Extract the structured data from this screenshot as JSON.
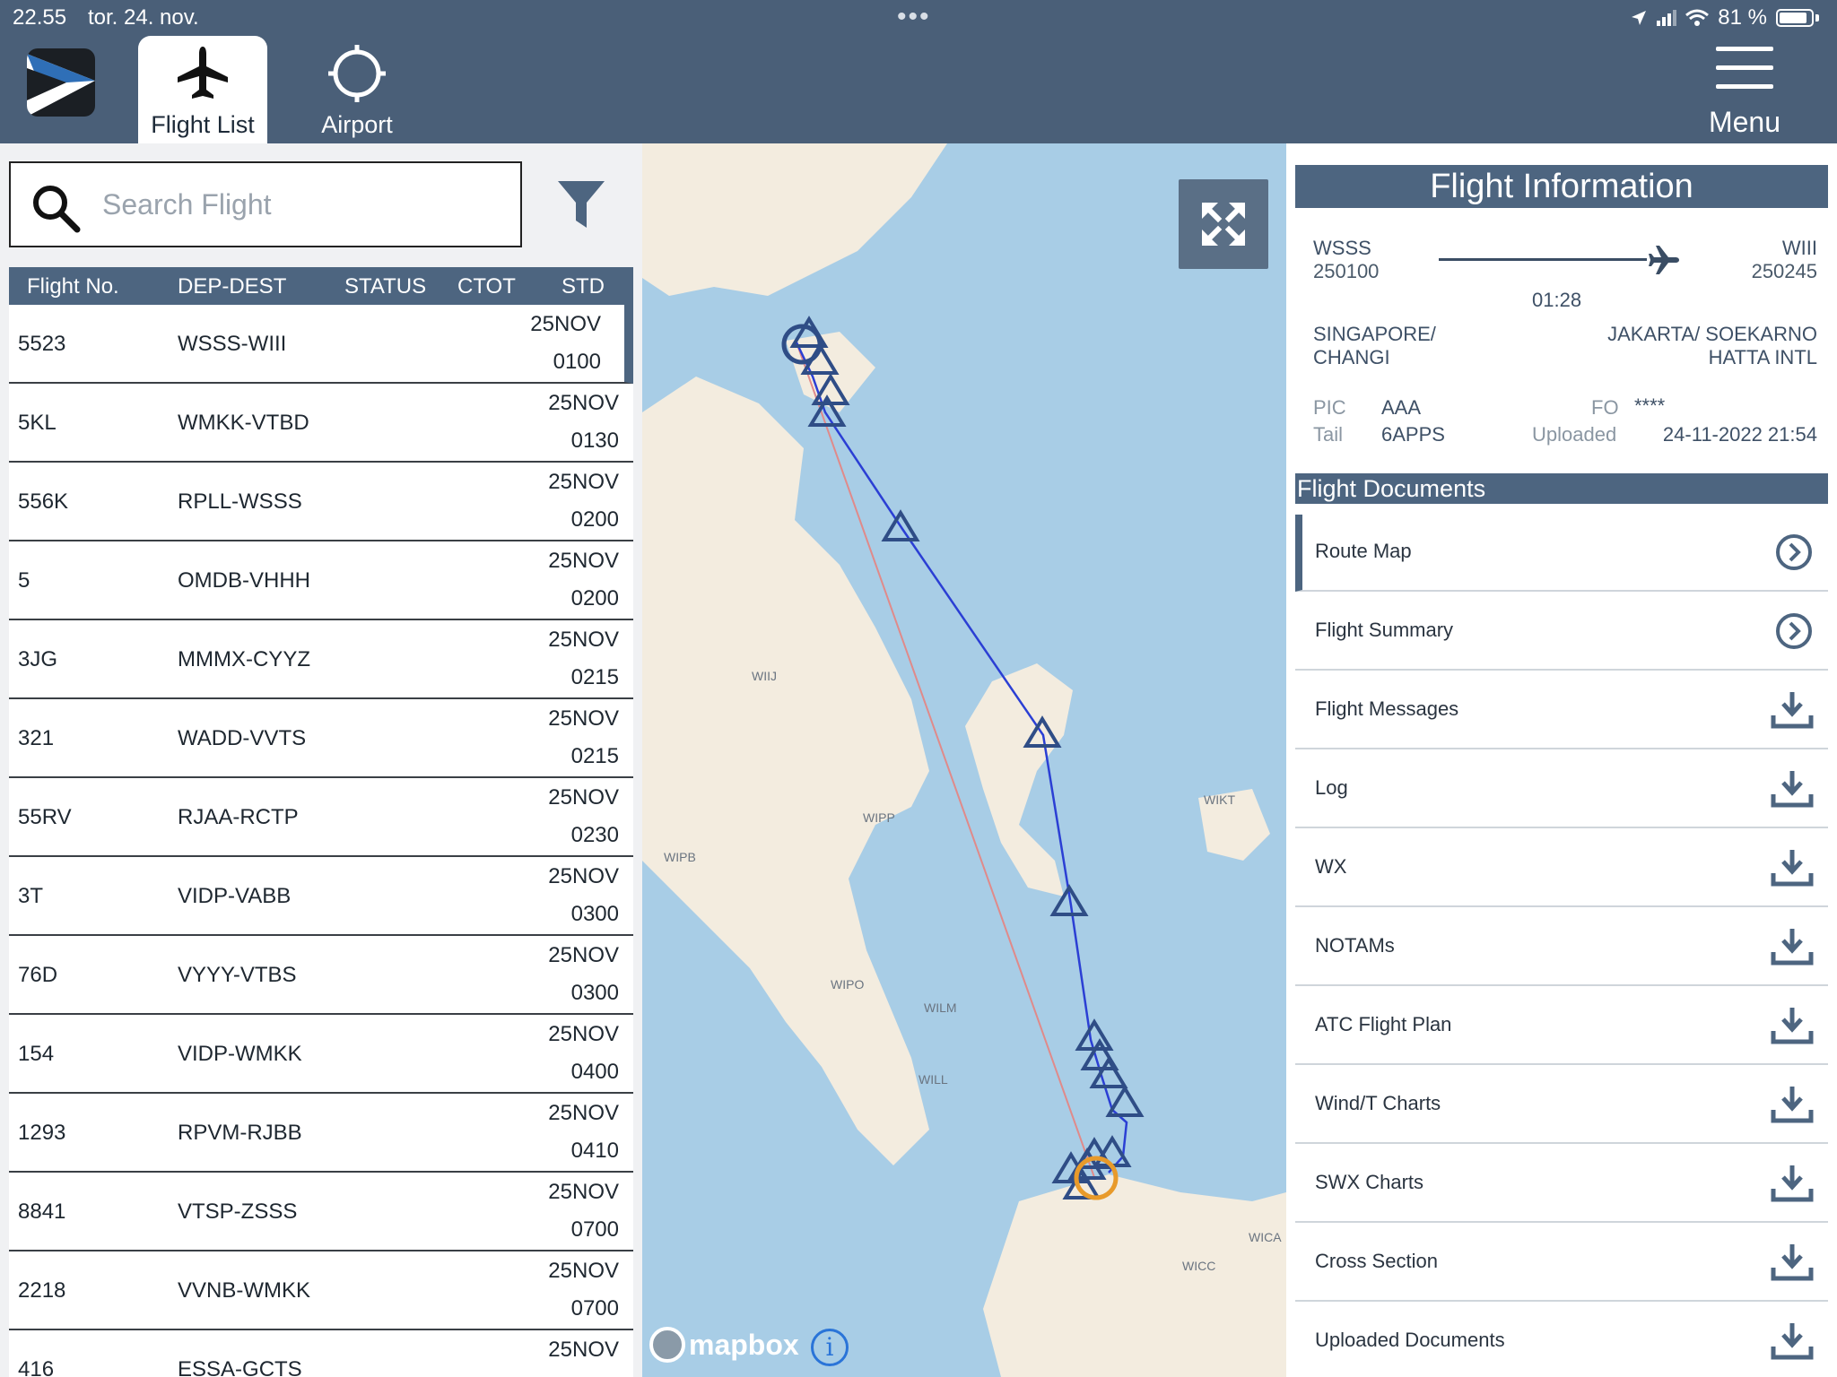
{
  "status_bar": {
    "time": "22.55",
    "date": "tor. 24. nov.",
    "battery": "81 %"
  },
  "tabs": [
    {
      "label": "Flight List",
      "icon": "airplane-icon",
      "active": true
    },
    {
      "label": "Airport",
      "icon": "crosshair-icon",
      "active": false
    }
  ],
  "menu": {
    "label": "Menu"
  },
  "search": {
    "placeholder": "Search Flight"
  },
  "flight_table": {
    "columns": [
      "Flight No.",
      "DEP-DEST",
      "STATUS",
      "CTOT",
      "STD"
    ],
    "rows": [
      {
        "no": "5523",
        "route": "WSSS-WIII",
        "date": "25NOV",
        "time": "0100",
        "selected": true
      },
      {
        "no": "5KL",
        "route": "WMKK-VTBD",
        "date": "25NOV",
        "time": "0130"
      },
      {
        "no": "556K",
        "route": "RPLL-WSSS",
        "date": "25NOV",
        "time": "0200"
      },
      {
        "no": "5",
        "route": "OMDB-VHHH",
        "date": "25NOV",
        "time": "0200"
      },
      {
        "no": "3JG",
        "route": "MMMX-CYYZ",
        "date": "25NOV",
        "time": "0215"
      },
      {
        "no": "321",
        "route": "WADD-VVTS",
        "date": "25NOV",
        "time": "0215"
      },
      {
        "no": "55RV",
        "route": "RJAA-RCTP",
        "date": "25NOV",
        "time": "0230"
      },
      {
        "no": "3T",
        "route": "VIDP-VABB",
        "date": "25NOV",
        "time": "0300"
      },
      {
        "no": "76D",
        "route": "VYYY-VTBS",
        "date": "25NOV",
        "time": "0300"
      },
      {
        "no": "154",
        "route": "VIDP-WMKK",
        "date": "25NOV",
        "time": "0400"
      },
      {
        "no": "1293",
        "route": "RPVM-RJBB",
        "date": "25NOV",
        "time": "0410"
      },
      {
        "no": "8841",
        "route": "VTSP-ZSSS",
        "date": "25NOV",
        "time": "0700"
      },
      {
        "no": "2218",
        "route": "VVNB-WMKK",
        "date": "25NOV",
        "time": "0700"
      },
      {
        "no": "416",
        "route": "ESSA-GCTS",
        "date": "25NOV",
        "time": ""
      }
    ]
  },
  "map": {
    "labels": [
      "WIIJ",
      "WIPP",
      "WIPB",
      "WIKT",
      "WIPO",
      "WILM",
      "WILL",
      "WICA",
      "WICC"
    ],
    "attribution": "mapbox",
    "info": "i",
    "colors": {
      "land": "#f3ecdf",
      "water": "#a8cde6",
      "route": "#2b3fd4",
      "direct": "#e08a8a",
      "waypoint": "#2f4d86",
      "destination": "#e89a2a"
    }
  },
  "flight_info": {
    "title": "Flight Information",
    "dep": {
      "code": "WSSS",
      "time": "250100",
      "name_line1": "SINGAPORE/",
      "name_line2": "CHANGI"
    },
    "dest": {
      "code": "WIII",
      "time": "250245",
      "name_line1": "JAKARTA/ SOEKARNO",
      "name_line2": "HATTA INTL"
    },
    "duration": "01:28",
    "pic_label": "PIC",
    "pic": "AAA",
    "fo_label": "FO",
    "fo": "****",
    "tail_label": "Tail",
    "tail": "6APPS",
    "uploaded_label": "Uploaded",
    "uploaded": "24-11-2022 21:54"
  },
  "documents": {
    "title": "Flight Documents",
    "items": [
      {
        "label": "Route Map",
        "icon": "chevron-circle-icon",
        "active": true
      },
      {
        "label": "Flight Summary",
        "icon": "chevron-circle-icon"
      },
      {
        "label": "Flight Messages",
        "icon": "download-icon"
      },
      {
        "label": "Log",
        "icon": "download-icon"
      },
      {
        "label": "WX",
        "icon": "download-icon"
      },
      {
        "label": "NOTAMs",
        "icon": "download-icon"
      },
      {
        "label": "ATC Flight Plan",
        "icon": "download-icon"
      },
      {
        "label": "Wind/T Charts",
        "icon": "download-icon"
      },
      {
        "label": "SWX Charts",
        "icon": "download-icon"
      },
      {
        "label": "Cross Section",
        "icon": "download-icon"
      },
      {
        "label": "Uploaded Documents",
        "icon": "download-icon"
      }
    ]
  }
}
